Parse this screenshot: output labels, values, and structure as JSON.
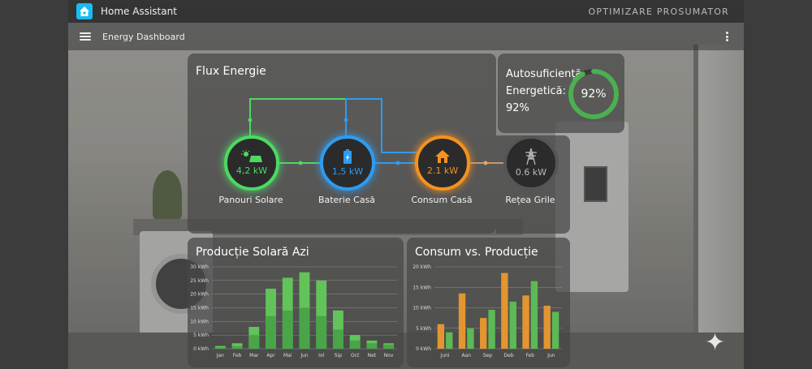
{
  "app": {
    "title": "Home Assistant",
    "header_right": "OPTIMIZARE PROSUMATOR"
  },
  "toolbar": {
    "page_title": "Energy Dashboard"
  },
  "flux": {
    "title": "Flux Energie",
    "nodes": [
      {
        "id": "solar",
        "value": "4,2 kW",
        "label": "Panouri Solare",
        "color": "#4cd964",
        "icon": "solar-panel-icon"
      },
      {
        "id": "battery",
        "value": "1,5 kW",
        "label": "Baterie Casă",
        "color": "#2f9bf0",
        "icon": "battery-icon"
      },
      {
        "id": "home",
        "value": "2.1 kW",
        "label": "Consum Casă",
        "color": "#f5921e",
        "icon": "home-icon"
      },
      {
        "id": "grid",
        "value": "0.6 kW",
        "label": "Rețea Grile",
        "color": "#3d3d3d",
        "icon": "power-tower-icon"
      }
    ]
  },
  "autosuficienta": {
    "label": "Autosuficiență Energetică: 92%",
    "value_text": "92%",
    "percent": 92,
    "color": "#4caf50"
  },
  "chart_data": [
    {
      "type": "bar",
      "title": "Producție Solară Azi",
      "categories": [
        "Jan",
        "Feb",
        "Mar",
        "Apr",
        "Mai",
        "Jun",
        "Iol",
        "Sip",
        "Oct",
        "Net",
        "Nov"
      ],
      "series": [
        {
          "values": [
            1,
            2,
            8,
            22,
            26,
            28,
            25,
            14,
            5,
            3,
            2
          ],
          "color": "#4aa548"
        },
        {
          "values": [
            0.5,
            1,
            5,
            12,
            14,
            15,
            12,
            7,
            3,
            2,
            1.5
          ],
          "color": "#62c35a"
        }
      ],
      "yticks": [
        "0 kWh",
        "5 kWh",
        "10 kWh",
        "15 kWh",
        "20 kWh",
        "25 kWh",
        "30 kWh"
      ],
      "ylim": [
        0,
        30
      ]
    },
    {
      "type": "bar",
      "title": "Consum vs. Producție",
      "categories": [
        "Juni",
        "Aan",
        "Sep",
        "Deb",
        "Feb",
        "Jun"
      ],
      "series": [
        {
          "values": [
            6,
            13.5,
            7.5,
            18.5,
            13,
            10.5
          ],
          "color": "#e29530"
        },
        {
          "values": [
            4,
            5,
            9.5,
            11.5,
            16.5,
            9
          ],
          "color": "#5cb955"
        }
      ],
      "yticks": [
        "0 kWh",
        "5 kWh",
        "10 kWh",
        "15 kWh",
        "20 kWh"
      ],
      "ylim": [
        0,
        20
      ]
    }
  ]
}
